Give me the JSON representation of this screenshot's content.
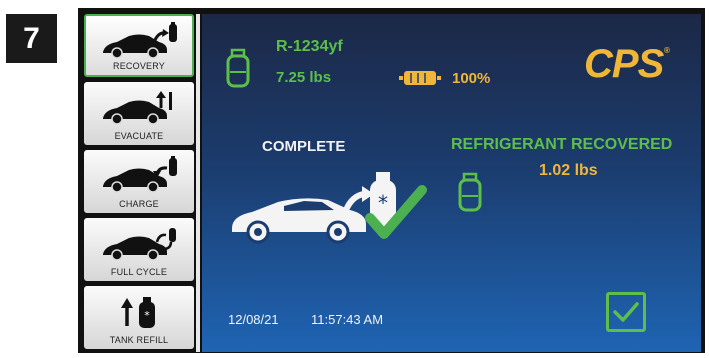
{
  "step": {
    "number": "7"
  },
  "sidebar": {
    "items": [
      {
        "label": "RECOVERY",
        "icon": "car-recovery-icon",
        "active": true
      },
      {
        "label": "EVACUATE",
        "icon": "car-evacuate-icon",
        "active": false
      },
      {
        "label": "CHARGE",
        "icon": "car-charge-icon",
        "active": false
      },
      {
        "label": "FULL CYCLE",
        "icon": "car-full-cycle-icon",
        "active": false
      },
      {
        "label": "TANK REFILL",
        "icon": "tank-refill-icon",
        "active": false
      }
    ]
  },
  "status": {
    "refrigerant_type": "R-1234yf",
    "tank_weight": "7.25 lbs",
    "battery_percent": "100%",
    "brand": "CPS"
  },
  "main": {
    "status_text": "COMPLETE",
    "recovered_title": "REFRIGERANT RECOVERED",
    "recovered_amount": "1.02 lbs"
  },
  "footer": {
    "date": "12/08/21",
    "time": "11:57:43 AM"
  },
  "colors": {
    "accent_green": "#5cbf4a",
    "gold": "#f0b63a",
    "screen_blue": "#1f64b3"
  }
}
